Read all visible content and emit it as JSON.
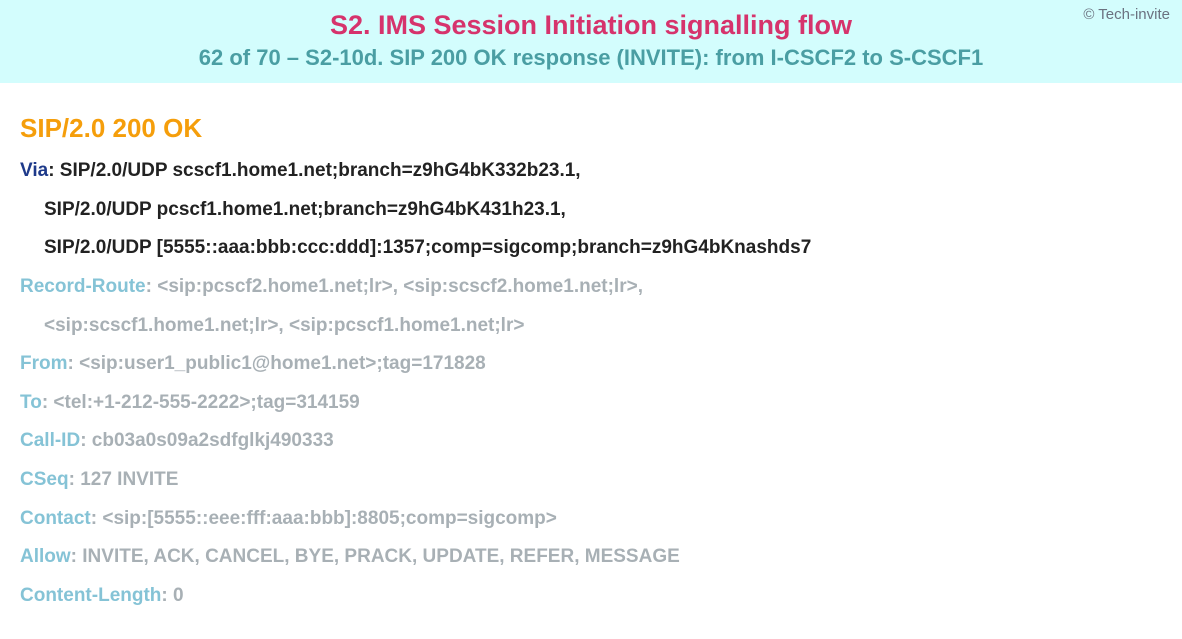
{
  "header": {
    "copyright": "© Tech-invite",
    "title": "S2. IMS Session Initiation signalling flow",
    "subtitle": "62 of 70 – S2-10d. SIP 200 OK response (INVITE): from I-CSCF2 to S-CSCF1"
  },
  "message": {
    "response_line": "SIP/2.0 200 OK",
    "via": {
      "name": "Via",
      "sep": ": ",
      "lines": [
        "SIP/2.0/UDP scscf1.home1.net;branch=z9hG4bK332b23.1,",
        "SIP/2.0/UDP pcscf1.home1.net;branch=z9hG4bK431h23.1,",
        "SIP/2.0/UDP [5555::aaa:bbb:ccc:ddd]:1357;comp=sigcomp;branch=z9hG4bKnashds7"
      ]
    },
    "record_route": {
      "name": "Record-Route",
      "sep": ": ",
      "lines": [
        "<sip:pcscf2.home1.net;lr>, <sip:scscf2.home1.net;lr>,",
        "<sip:scscf1.home1.net;lr>, <sip:pcscf1.home1.net;lr>"
      ]
    },
    "from": {
      "name": "From",
      "sep": ": ",
      "value": "<sip:user1_public1@home1.net>;tag=171828"
    },
    "to": {
      "name": "To",
      "sep": ": ",
      "value": "<tel:+1-212-555-2222>;tag=314159"
    },
    "call_id": {
      "name": "Call-ID",
      "sep": ": ",
      "value": "cb03a0s09a2sdfglkj490333"
    },
    "cseq": {
      "name": "CSeq",
      "sep": ": ",
      "value": "127 INVITE"
    },
    "contact": {
      "name": "Contact",
      "sep": ": ",
      "value": "<sip:[5555::eee:fff:aaa:bbb]:8805;comp=sigcomp>"
    },
    "allow": {
      "name": "Allow",
      "sep": ": ",
      "value": "INVITE, ACK, CANCEL, BYE, PRACK, UPDATE, REFER, MESSAGE"
    },
    "content_length": {
      "name": "Content-Length",
      "sep": ": ",
      "value": "0"
    }
  }
}
